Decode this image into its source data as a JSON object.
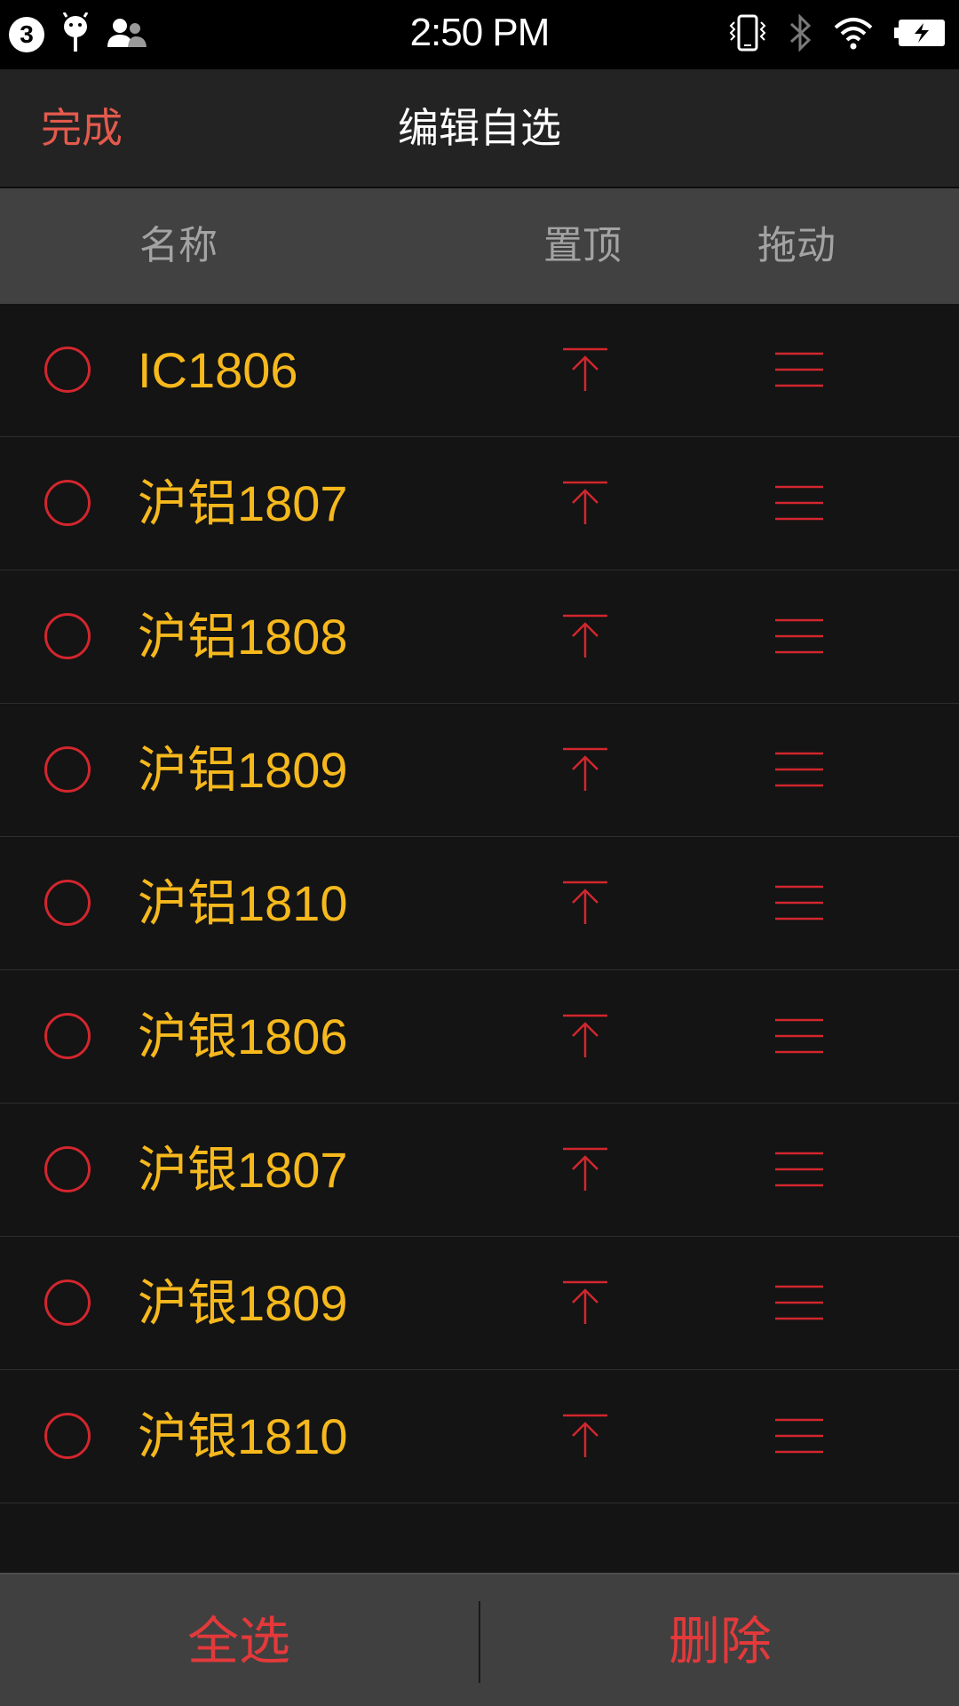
{
  "status_bar": {
    "notification_count": "3",
    "time": "2:50 PM",
    "left_icons": [
      "notification-count-badge",
      "android-icon",
      "contacts-icon"
    ],
    "right_icons": [
      "vibrate-icon",
      "bluetooth-icon",
      "wifi-icon",
      "battery-icon"
    ]
  },
  "header": {
    "done_label": "完成",
    "title": "编辑自选"
  },
  "columns": {
    "name": "名称",
    "pin_top": "置顶",
    "drag": "拖动"
  },
  "items": [
    {
      "name": "IC1806"
    },
    {
      "name": "沪铝1807"
    },
    {
      "name": "沪铝1808"
    },
    {
      "name": "沪铝1809"
    },
    {
      "name": "沪铝1810"
    },
    {
      "name": "沪银1806"
    },
    {
      "name": "沪银1807"
    },
    {
      "name": "沪银1809"
    },
    {
      "name": "沪银1810"
    }
  ],
  "footer": {
    "select_all_label": "全选",
    "delete_label": "删除"
  },
  "colors": {
    "accent_red": "#d2262e",
    "item_yellow": "#f6b81c",
    "done_text": "#e35a4d"
  }
}
